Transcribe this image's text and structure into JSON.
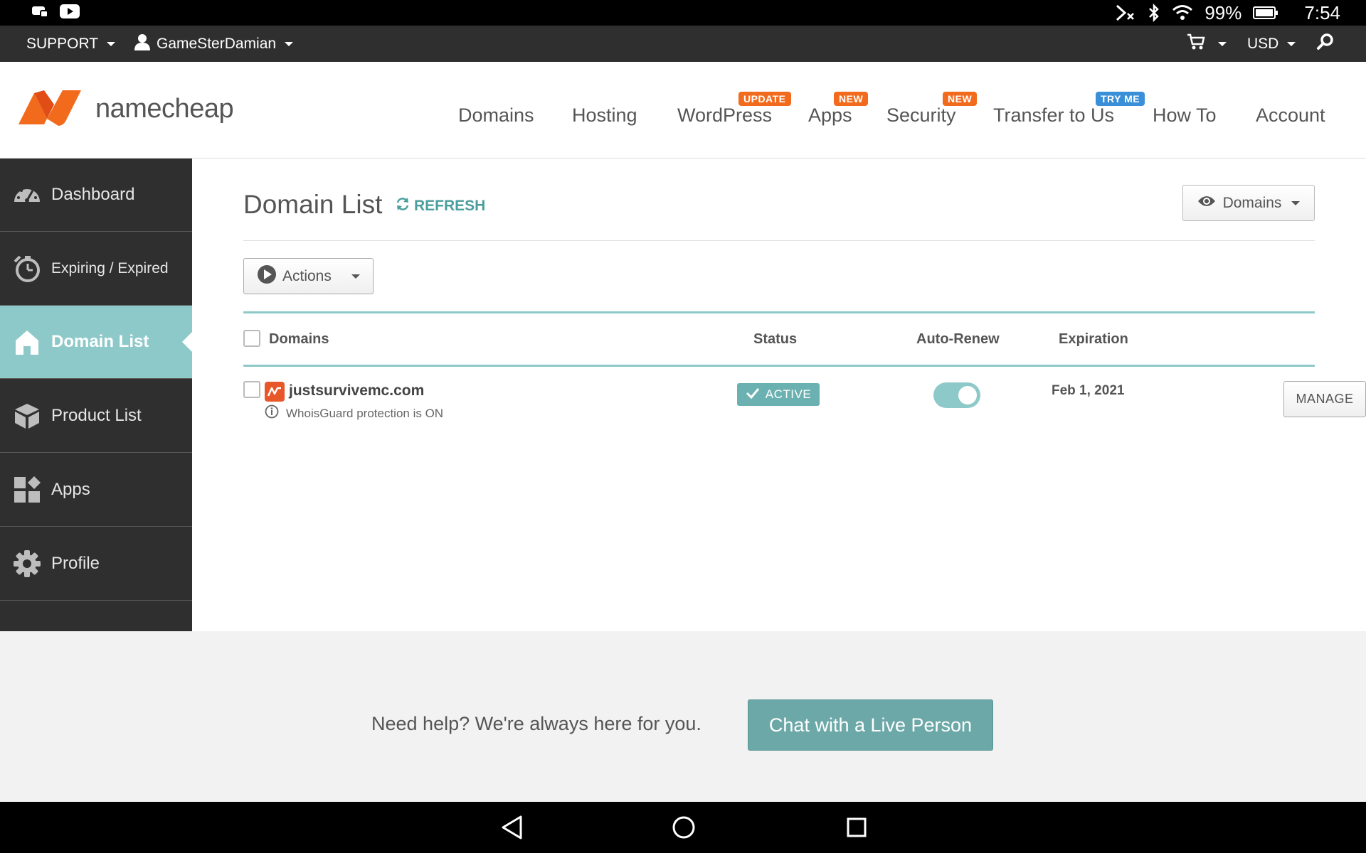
{
  "status_bar": {
    "battery": "99%",
    "time": "7:54"
  },
  "topbar": {
    "support_label": "SUPPORT",
    "username": "GameSterDamian",
    "currency": "USD"
  },
  "header": {
    "logo_text": "namecheap",
    "nav": [
      {
        "label": "Domains",
        "badge": ""
      },
      {
        "label": "Hosting",
        "badge": ""
      },
      {
        "label": "WordPress",
        "badge": "UPDATE"
      },
      {
        "label": "Apps",
        "badge": "NEW"
      },
      {
        "label": "Security",
        "badge": "NEW"
      },
      {
        "label": "Transfer to Us",
        "badge": "TRY ME"
      },
      {
        "label": "How To",
        "badge": ""
      },
      {
        "label": "Account",
        "badge": ""
      }
    ]
  },
  "sidebar": {
    "items": [
      {
        "label": "Dashboard",
        "icon": "dashboard-gauge-icon"
      },
      {
        "label": "Expiring / Expired",
        "icon": "stopwatch-icon"
      },
      {
        "label": "Domain List",
        "icon": "home-icon",
        "active": true
      },
      {
        "label": "Product List",
        "icon": "box-icon"
      },
      {
        "label": "Apps",
        "icon": "apps-grid-icon"
      },
      {
        "label": "Profile",
        "icon": "gear-icon"
      }
    ]
  },
  "main": {
    "title": "Domain List",
    "refresh_label": "REFRESH",
    "view_dropdown": "Domains",
    "actions_label": "Actions",
    "columns": {
      "domains": "Domains",
      "status": "Status",
      "auto_renew": "Auto-Renew",
      "expiration": "Expiration"
    },
    "rows": [
      {
        "domain": "justsurvivemc.com",
        "whois": "WhoisGuard protection is ON",
        "status": "ACTIVE",
        "auto_renew": true,
        "expiration": "Feb 1, 2021",
        "manage_label": "MANAGE"
      }
    ]
  },
  "help": {
    "text": "Need help? We're always here for you.",
    "chat_button": "Chat with a Live Person"
  },
  "colors": {
    "accent_teal": "#8ec9c9",
    "brand_orange": "#f26b1d",
    "dark_bg": "#2f2f2f"
  }
}
